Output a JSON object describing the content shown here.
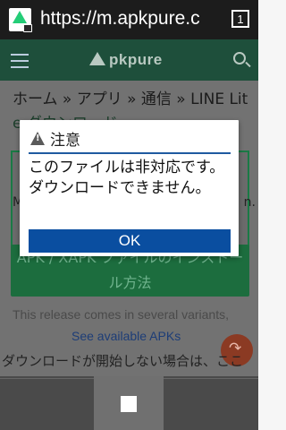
{
  "browser": {
    "url": "https://m.apkpure.c",
    "tab_count": "1"
  },
  "site": {
    "logo_text": "pkpure"
  },
  "page": {
    "breadcrumb": "ホーム » アプリ » 通信 » LINE Lit",
    "breadcrumb_2": "e  ダウンロード",
    "card_edge_left": "M",
    "card_edge_right": "n.",
    "install_label": "APK / XAPK ファイルのインストール方法",
    "variants_text": "This release comes in several variants,",
    "see_apks": "See available APKs",
    "download_hint": "ダウンロードが開始しない場合は、ここ"
  },
  "dialog": {
    "title": "注意",
    "message": "このファイルは非対応です。ダウンロードできません。",
    "ok_label": "OK"
  }
}
